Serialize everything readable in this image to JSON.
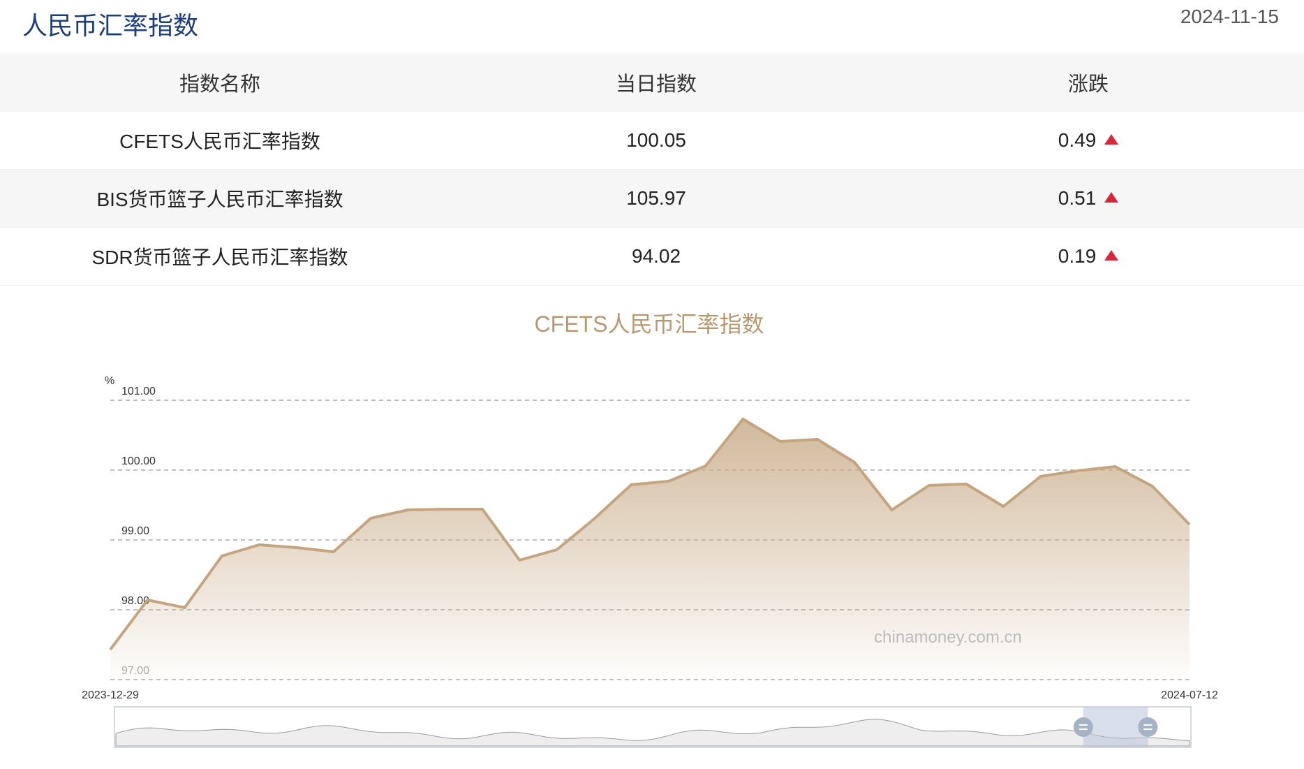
{
  "header": {
    "title": "人民币汇率指数",
    "date": "2024-11-15"
  },
  "table": {
    "columns": [
      "指数名称",
      "当日指数",
      "涨跌"
    ],
    "rows": [
      {
        "name": "CFETS人民币汇率指数",
        "value": "100.05",
        "change": "0.49",
        "direction": "up"
      },
      {
        "name": "BIS货币篮子人民币汇率指数",
        "value": "105.97",
        "change": "0.51",
        "direction": "up"
      },
      {
        "name": "SDR货币篮子人民币汇率指数",
        "value": "94.02",
        "change": "0.19",
        "direction": "up"
      }
    ]
  },
  "colors": {
    "title": "#1d3e7a",
    "change_up": "#d6283a",
    "chart_line": "#c4a57f",
    "chart_title": "#b89970"
  },
  "chart_data": {
    "type": "area",
    "title": "CFETS人民币汇率指数",
    "ylabel": "%",
    "ylim": [
      97.0,
      101.0
    ],
    "yticks": [
      "97.00",
      "98.00",
      "99.00",
      "100.00",
      "101.00"
    ],
    "x_start_label": "2023-12-29",
    "x_end_label": "2024-07-12",
    "grid": true,
    "watermark": "chinamoney.com.cn",
    "values": [
      97.43,
      98.14,
      98.03,
      98.77,
      98.93,
      98.89,
      98.83,
      99.31,
      99.43,
      99.44,
      99.44,
      98.71,
      98.86,
      99.3,
      99.79,
      99.84,
      100.06,
      100.73,
      100.41,
      100.44,
      100.11,
      99.43,
      99.78,
      99.8,
      99.48,
      99.91,
      99.99,
      100.05,
      99.77,
      99.22
    ],
    "zoom_range": [
      0.9,
      0.96
    ]
  }
}
